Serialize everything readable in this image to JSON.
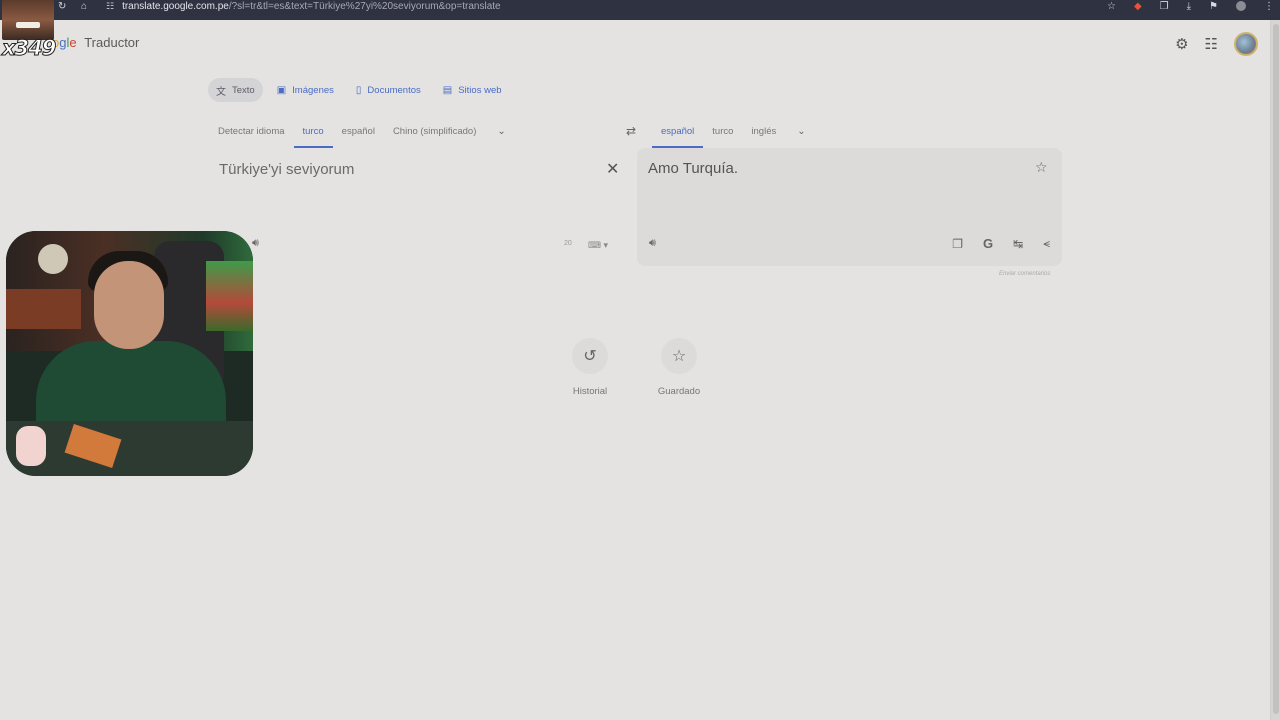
{
  "browser": {
    "url_host": "translate.google.com.pe",
    "url_rest": "/?sl=tr&tl=es&text=Türkiye%27yi%20seviyorum&op=translate",
    "nav_icons": [
      "back-icon",
      "reload-icon",
      "home-icon"
    ],
    "toolbar_icons": [
      "bookmark-star-icon",
      "extension-icon",
      "puzzle-icon",
      "download-icon",
      "extensions-icon",
      "profile-icon",
      "menu-icon"
    ]
  },
  "overlay": {
    "counter": "x349"
  },
  "header": {
    "logo_letters": [
      "o",
      "g",
      "l",
      "e"
    ],
    "product": "Traductor"
  },
  "tabs": [
    {
      "label": "Texto",
      "icon": "translate-icon",
      "active": true
    },
    {
      "label": "Imágenes",
      "icon": "image-icon",
      "active": false
    },
    {
      "label": "Documentos",
      "icon": "document-icon",
      "active": false
    },
    {
      "label": "Sitios web",
      "icon": "website-icon",
      "active": false
    }
  ],
  "source_languages": {
    "detect": "Detectar idioma",
    "options": [
      "turco",
      "español",
      "Chino (simplificado)"
    ],
    "selected": "turco"
  },
  "target_languages": {
    "options": [
      "español",
      "turco",
      "inglés"
    ],
    "selected": "español"
  },
  "source": {
    "text": "Türkiye'yi seviyorum",
    "char_count": "20"
  },
  "target": {
    "text": "Amo Turquía.",
    "feedback": "Enviar comentarios"
  },
  "shortcuts": {
    "history": "Historial",
    "saved": "Guardado"
  },
  "colors": {
    "accent": "#4a6cc4",
    "background": "#e4e3e1",
    "chrome": "#2f3240"
  }
}
